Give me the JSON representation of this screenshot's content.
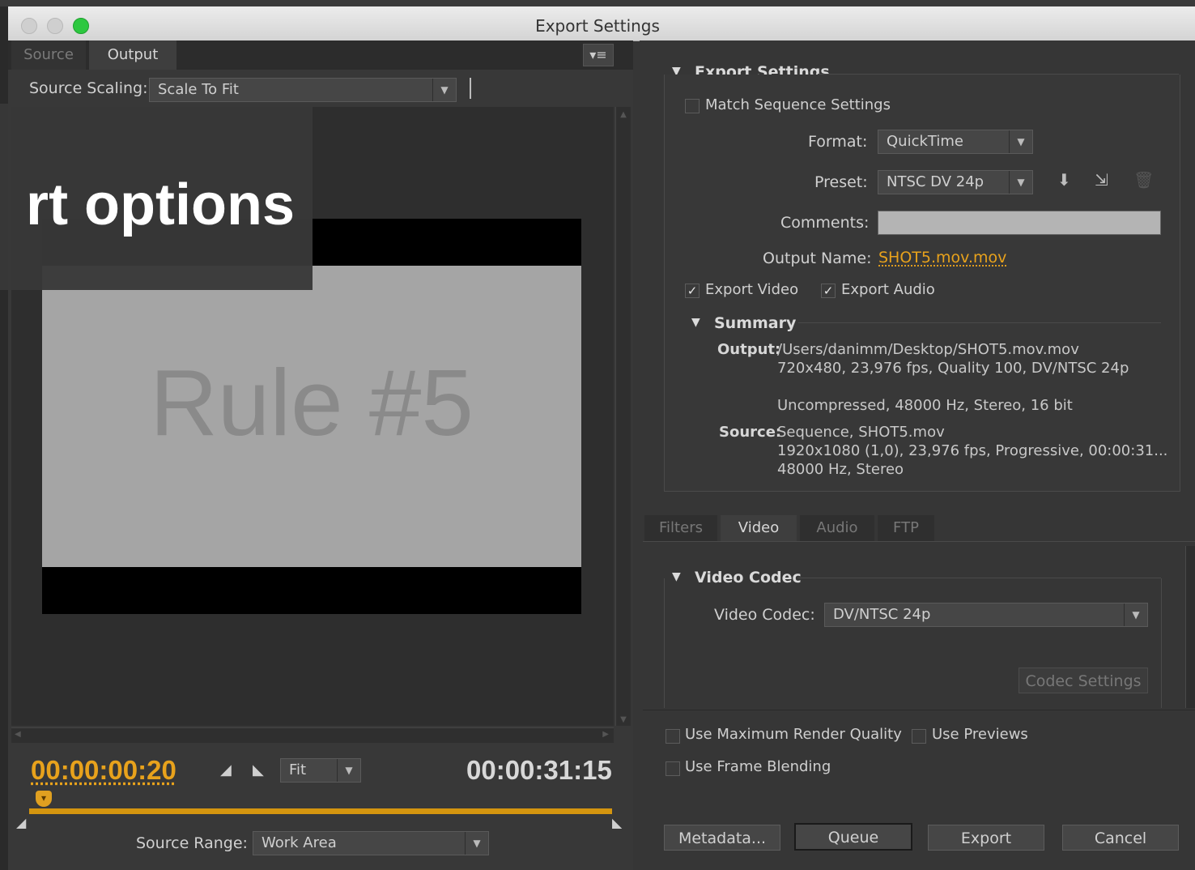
{
  "window": {
    "title": "Export Settings"
  },
  "left": {
    "tabs": [
      "Source",
      "Output"
    ],
    "source_scaling": {
      "label": "Source Scaling:",
      "value": "Scale To Fit"
    },
    "preview_text": "Rule #5",
    "overlay_caption": "rt options",
    "timecode_current": "00:00:00:20",
    "timecode_duration": "00:00:31:15",
    "zoom_value": "Fit",
    "source_range": {
      "label": "Source Range:",
      "value": "Work Area"
    }
  },
  "export": {
    "section_title": "Export Settings",
    "match_sequence": "Match Sequence Settings",
    "format": {
      "label": "Format:",
      "value": "QuickTime"
    },
    "preset": {
      "label": "Preset:",
      "value": "NTSC DV 24p"
    },
    "comments_label": "Comments:",
    "output_name": {
      "label": "Output Name:",
      "value": "SHOT5.mov.mov"
    },
    "export_video": "Export Video",
    "export_audio": "Export Audio",
    "summary": {
      "title": "Summary",
      "output_label": "Output:",
      "output_lines": [
        "/Users/danimm/Desktop/SHOT5.mov.mov",
        "720x480, 23,976 fps, Quality 100, DV/NTSC 24p",
        "Uncompressed, 48000 Hz, Stereo, 16 bit"
      ],
      "source_label": "Source:",
      "source_lines": [
        "Sequence, SHOT5.mov",
        "1920x1080 (1,0), 23,976 fps, Progressive, 00:00:31...",
        "48000 Hz, Stereo"
      ]
    }
  },
  "settings_tabs": [
    "Filters",
    "Video",
    "Audio",
    "FTP"
  ],
  "video_codec": {
    "section_title": "Video Codec",
    "label": "Video Codec:",
    "value": "DV/NTSC 24p",
    "codec_settings": "Codec Settings"
  },
  "options": {
    "max_render": "Use Maximum Render Quality",
    "use_previews": "Use Previews",
    "frame_blending": "Use Frame Blending"
  },
  "buttons": {
    "metadata": "Metadata...",
    "queue": "Queue",
    "export": "Export",
    "cancel": "Cancel"
  }
}
